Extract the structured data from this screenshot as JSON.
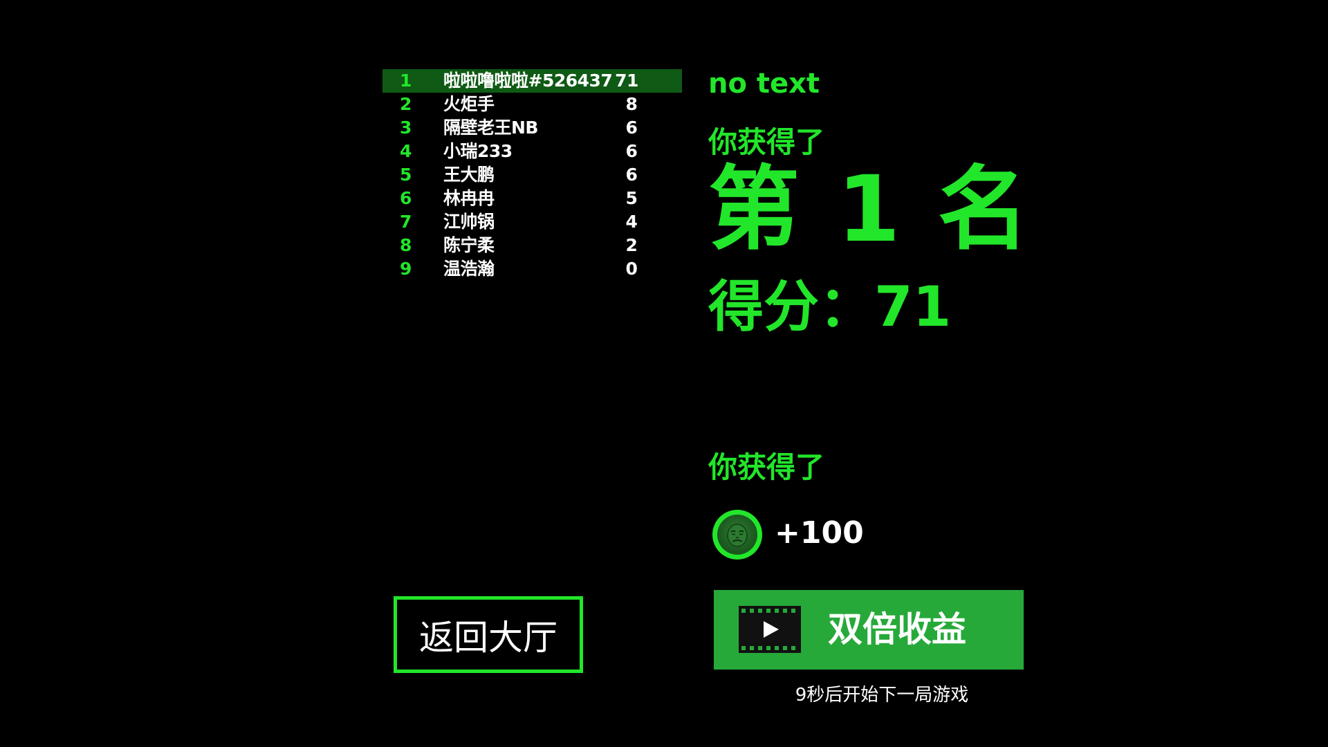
{
  "leaderboard": {
    "rows": [
      {
        "rank": "1",
        "name": "啦啦噜啦啦#526437",
        "score": "71"
      },
      {
        "rank": "2",
        "name": "火炬手",
        "score": "8"
      },
      {
        "rank": "3",
        "name": "隔壁老王NB",
        "score": "6"
      },
      {
        "rank": "4",
        "name": "小瑞233",
        "score": "6"
      },
      {
        "rank": "5",
        "name": "王大鹏",
        "score": "6"
      },
      {
        "rank": "6",
        "name": "林冉冉",
        "score": "5"
      },
      {
        "rank": "7",
        "name": "江帅锅",
        "score": "4"
      },
      {
        "rank": "8",
        "name": "陈宁柔",
        "score": "2"
      },
      {
        "rank": "9",
        "name": "温浩瀚",
        "score": "0"
      }
    ]
  },
  "result": {
    "no_text": "no text",
    "gain_label": "你获得了",
    "rank_text": "第 1 名",
    "score_text": "得分：71",
    "gain_label_2": "你获得了",
    "reward_amount": "+100"
  },
  "buttons": {
    "back_label": "返回大厅",
    "double_label": "双倍收益"
  },
  "countdown_text": "9秒后开始下一局游戏",
  "colors": {
    "accent": "#22e62a",
    "highlight_row": "#0f5a14",
    "button_green": "#27a93a",
    "background": "#000000"
  },
  "icons": {
    "coin": "coin-face-icon",
    "video": "video-play-icon"
  }
}
